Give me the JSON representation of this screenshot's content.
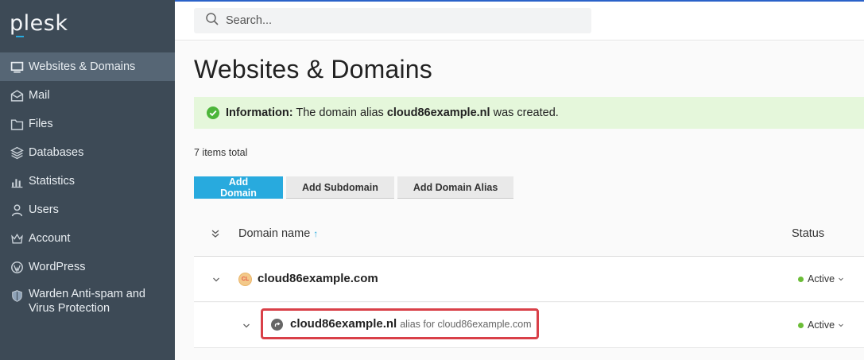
{
  "app": {
    "logo": "plesk"
  },
  "colors": {
    "sidebar_bg": "#3d4a56",
    "active_bg": "#566675",
    "accent": "#28aade",
    "success_bg": "#e5f7db",
    "status_active": "#6bbd37",
    "highlight": "#d94048"
  },
  "sidebar": {
    "items": [
      {
        "label": "Websites & Domains",
        "icon": "monitor-icon",
        "active": true
      },
      {
        "label": "Mail",
        "icon": "envelope-icon"
      },
      {
        "label": "Files",
        "icon": "folder-icon"
      },
      {
        "label": "Databases",
        "icon": "layers-icon"
      },
      {
        "label": "Statistics",
        "icon": "bar-chart-icon"
      },
      {
        "label": "Users",
        "icon": "user-icon"
      },
      {
        "label": "Account",
        "icon": "crown-icon"
      },
      {
        "label": "WordPress",
        "icon": "wordpress-icon"
      },
      {
        "label_line1": "Warden Anti-spam and",
        "label_line2": "Virus Protection",
        "icon": "shield-icon"
      }
    ]
  },
  "search": {
    "placeholder": "Search..."
  },
  "main": {
    "title": "Websites & Domains",
    "info": {
      "prefix": "Information:",
      "text_before": "The domain alias",
      "domain": "cloud86example.nl",
      "text_after": "was created."
    },
    "count": "7 items total",
    "buttons": {
      "add_domain": "Add Domain",
      "add_subdomain": "Add Subdomain",
      "add_alias": "Add Domain Alias"
    },
    "table": {
      "columns": {
        "domain": "Domain name",
        "sort_indicator": "↑",
        "status": "Status"
      },
      "rows": [
        {
          "badge": "CL",
          "name": "cloud86example.com",
          "status": "Active"
        },
        {
          "name": "cloud86example.nl",
          "note": "alias for cloud86example.com",
          "status": "Active",
          "highlighted": true
        }
      ]
    }
  }
}
